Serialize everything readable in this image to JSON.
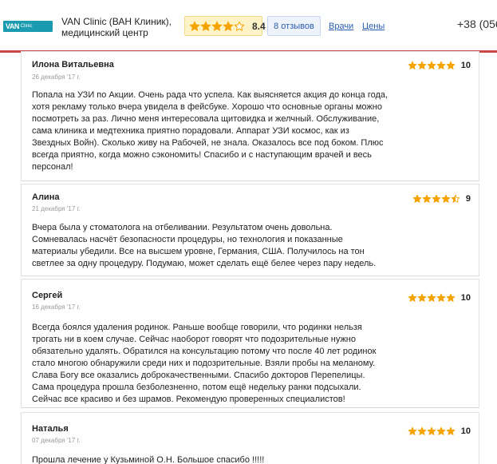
{
  "header": {
    "logo_mark": "VAN",
    "logo_text": "Clinic",
    "clinic_name": "VAN Clinic (ВАН Клиник),",
    "clinic_subtitle": "медицинский центр",
    "rating": "8.4",
    "rating_stars": 4.2,
    "reviews_label": "8 отзывов",
    "nav_doctors": "Врачи",
    "nav_prices": "Цены",
    "phone": "+38 (056"
  },
  "colors": {
    "accent_red": "#c74646",
    "star": "#f5a300",
    "link": "#2a5db0"
  },
  "reviews": [
    {
      "name": "Илона Витальевна",
      "date": "26 декабря '17 г.",
      "stars": 5,
      "score": "10",
      "lines": [
        "Попала на УЗИ по Акции. Очень рада что успела. Как выясняется акция до конца года,",
        "хотя рекламу только вчера увидела в фейсбуке. Хорошо что основные органы можно",
        "посмотреть за раз. Лично меня интересовала щитовидка и желчный. Обслуживание,",
        "сама клиника и медтехника приятно порадовали. Аппарат УЗИ космос, как из",
        "Звездных Войн). Сколько живу на Рабочей, не знала. Оказалось все под боком. Плюс",
        "всегда приятно, когда можно сэкономить! Спасибо и с наступающим врачей и весь",
        "персонал!"
      ]
    },
    {
      "name": "Алина",
      "date": "21 декабря '17 г.",
      "stars": 4.5,
      "score": "9",
      "lines": [
        "Вчера была у стоматолога на отбеливании. Результатом очень довольна.",
        "Сомневалась насчёт безопасности процедуры, но технология и показанные",
        "материалы убедили. Все на высшем уровне, Германия, США. Получилось на тон",
        "светлее за одну процедуру. Подумаю, может сделать ещё белее через пару недель."
      ]
    },
    {
      "name": "Сергей",
      "date": "16 декабря '17 г.",
      "stars": 5,
      "score": "10",
      "lines": [
        "Всегда боялся удаления родинок. Раньше вообще говорили, что родинки нельзя",
        "трогать ни в коем случае. Сейчас наоборот говорят что подозрительные нужно",
        "обязательно удалять. Обратился на консультацию потому что после 40 лет родинок",
        "стало многою обнаружили среди них и подозрительные. Взяли пробы на меланому.",
        "Слава Богу все оказались доброкачественными. Спасибо докторов Перепелицы.",
        "Сама процедура прошла безболезненно, потом ещё недельку ранки подсыхали.",
        "Сейчас все красиво и без шрамов. Рекомендую проверенных специалистов!"
      ]
    },
    {
      "name": "Наталья",
      "date": "07 декабря '17 г.",
      "stars": 5,
      "score": "10",
      "lines": [
        "Прошла лечение у Кузьминой О.Н. Большое спасибо !!!!!"
      ]
    }
  ]
}
